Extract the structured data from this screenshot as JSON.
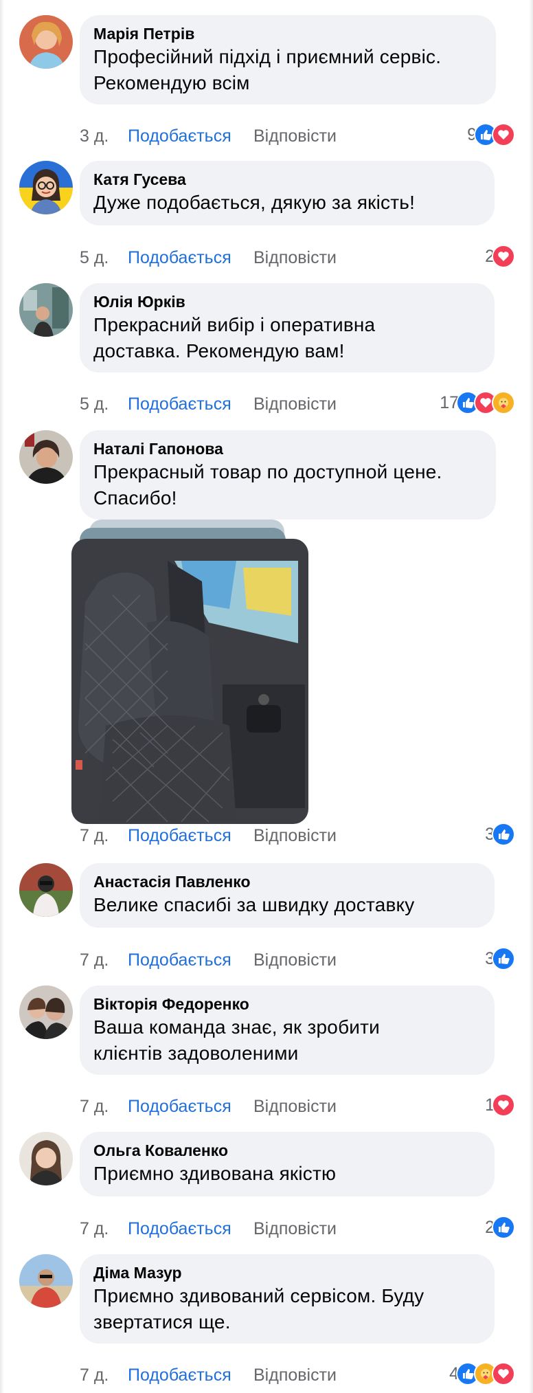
{
  "labels": {
    "like": "Подобається",
    "reply": "Відповісти"
  },
  "colors": {
    "like_blue": "#1877f2",
    "love_red": "#f33e58",
    "care_yellow": "#f7b125",
    "bubble": "#f0f2f5",
    "meta_gray": "#65676b"
  },
  "comments": [
    {
      "author": "Марія Петрів",
      "lines": [
        "Професійний підхід і приємний сервіс.",
        "Рекомендую всім"
      ],
      "time": "3 д.",
      "count": "9",
      "reactions": [
        "like-icon",
        "love-icon"
      ]
    },
    {
      "author": "Катя Гусева",
      "lines": [
        "Дуже подобається, дякую за якість!"
      ],
      "time": "5 д.",
      "count": "2",
      "reactions": [
        "love-icon"
      ]
    },
    {
      "author": "Юлія Юрків",
      "lines": [
        "Прекрасний вибір і оперативна",
        "доставка. Рекомендую вам!"
      ],
      "time": "5 д.",
      "count": "17",
      "reactions": [
        "like-icon",
        "love-icon",
        "care-icon"
      ]
    },
    {
      "author": "Наталі Гапонова",
      "lines": [
        "Прекрасный товар по доступной цене.",
        "Спасибо!"
      ],
      "time": "7 д.",
      "count": "3",
      "reactions": [
        "like-icon"
      ],
      "has_photo": true
    },
    {
      "author": "Анастасія Павленко",
      "lines": [
        "Велике спасибі за швидку доставку"
      ],
      "time": "7 д.",
      "count": "3",
      "reactions": [
        "like-icon"
      ]
    },
    {
      "author": "Вікторія Федоренко",
      "lines": [
        "Ваша команда знає, як зробити",
        "клієнтів задоволеними"
      ],
      "time": "7 д.",
      "count": "1",
      "reactions": [
        "love-icon"
      ]
    },
    {
      "author": "Ольга Коваленко",
      "lines": [
        "Приємно здивована якістю"
      ],
      "time": "7 д.",
      "count": "2",
      "reactions": [
        "like-icon"
      ]
    },
    {
      "author": "Діма Мазур",
      "lines": [
        "Приємно здивований сервісом. Буду",
        "звертатися ще."
      ],
      "time": "7 д.",
      "count": "4",
      "reactions": [
        "like-icon",
        "care-icon",
        "love-icon"
      ]
    }
  ]
}
